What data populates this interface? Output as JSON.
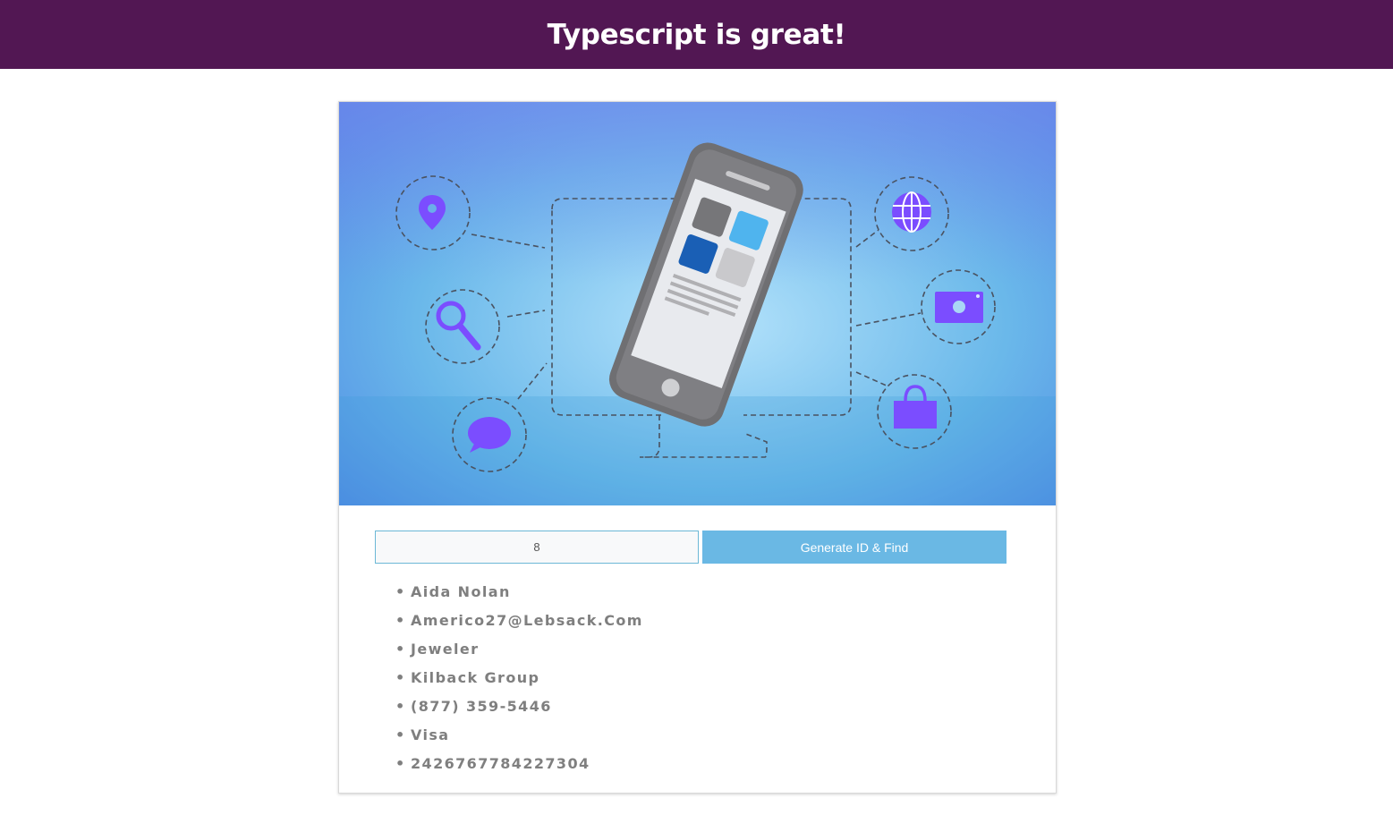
{
  "header": {
    "title": "Typescript is great!"
  },
  "search": {
    "value": "8",
    "button_label": "Generate ID & Find"
  },
  "details": [
    "Aida Nolan",
    "Americo27@Lebsack.Com",
    "Jeweler",
    "Kilback Group",
    "(877) 359-5446",
    "Visa",
    "2426767784227304"
  ],
  "colors": {
    "header_bg": "#521753",
    "button_bg": "#6ab8e4",
    "accent_icon": "#7b4dff"
  },
  "hero_icons": [
    "location-pin-icon",
    "search-icon",
    "chat-bubble-icon",
    "globe-icon",
    "camera-icon",
    "shopping-bag-icon",
    "smartphone-illustration"
  ]
}
